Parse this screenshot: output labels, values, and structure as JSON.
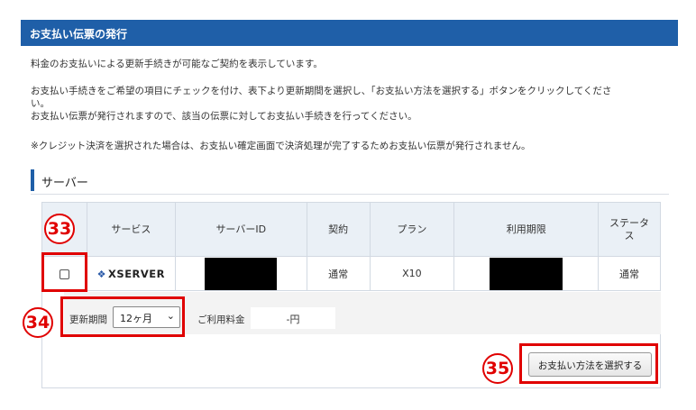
{
  "header": {
    "title": "お支払い伝票の発行"
  },
  "intro": {
    "p1": "料金のお支払いによる更新手続きが可能なご契約を表示しています。",
    "p2_line1": "お支払い手続きをご希望の項目にチェックを付け、表下より更新期間を選択し、「お支払い方法を選択する」ボタンをクリックしてくださ",
    "p2_line2": "い。",
    "p2_line3": "お支払い伝票が発行されますので、該当の伝票に対してお支払い手続きを行ってください。",
    "p4": "※クレジット決済を選択された場合は、お支払い確定画面で決済処理が完了するためお支払い伝票が発行されません。"
  },
  "section": {
    "title": "サーバー"
  },
  "table": {
    "headers": {
      "service": "サービス",
      "server_id": "サーバーID",
      "contract": "契約",
      "plan": "プラン",
      "period": "利用期限",
      "status_line1": "ステータ",
      "status_line2": "ス"
    },
    "row": {
      "service": "XSERVER",
      "contract": "通常",
      "plan": "X10",
      "status": "通常"
    }
  },
  "options": {
    "period_label": "更新期間",
    "period_value": "12ヶ月",
    "fee_label": "ご利用料金",
    "fee_value": "-円"
  },
  "actions": {
    "pay_button": "お支払い方法を選択する"
  },
  "annotations": {
    "n33": "33",
    "n34": "34",
    "n35": "35"
  },
  "colors": {
    "header": "#1f5fa8",
    "annotation": "#e00000",
    "table_header": "#eaf0f6"
  }
}
